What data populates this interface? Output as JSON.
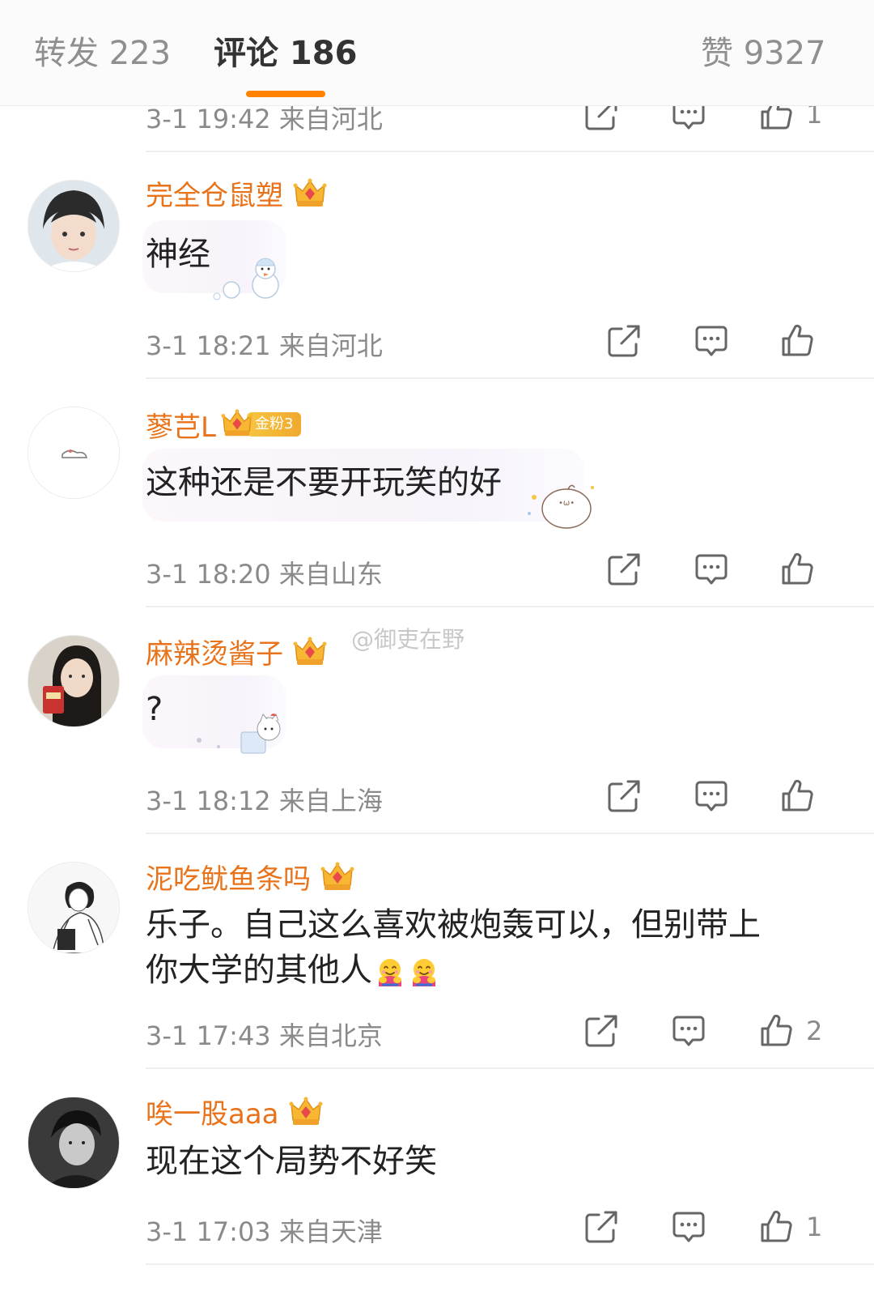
{
  "tabs": [
    {
      "label": "转发 223"
    },
    {
      "label": "评论 186"
    },
    {
      "label": "赞 9327"
    }
  ],
  "watermark": "@御吏在野",
  "top_partial": {
    "meta": "3-1 19:42  来自河北",
    "like_count": "1"
  },
  "comments": [
    {
      "username": "完全仓鼠塑",
      "text": "神经",
      "meta": "3-1 18:21  来自河北",
      "like_count": ""
    },
    {
      "username": "蓼芑L",
      "badge": "金粉3",
      "text": "这种还是不要开玩笑的好",
      "meta": "3-1 18:20  来自山东",
      "like_count": ""
    },
    {
      "username": "麻辣烫酱子",
      "text": "?",
      "meta": "3-1 18:12  来自上海",
      "like_count": ""
    },
    {
      "username": "泥吃鱿鱼条吗",
      "text_line1": "乐子。自己这么喜欢被炮轰可以，但别带上",
      "text_line2": "你大学的其他人",
      "meta": "3-1 17:43  来自北京",
      "like_count": "2"
    },
    {
      "username": "唉一股aaa",
      "text": "现在这个局势不好笑",
      "meta": "3-1 17:03  来自天津",
      "like_count": "1"
    }
  ],
  "colors": {
    "accent": "#ff8200",
    "username": "#e8731a",
    "meta": "#8a8a8a",
    "badge": "#f0a92e"
  },
  "icons": [
    "share-icon",
    "comment-icon",
    "like-icon",
    "crown-icon",
    "hug-emoji"
  ]
}
